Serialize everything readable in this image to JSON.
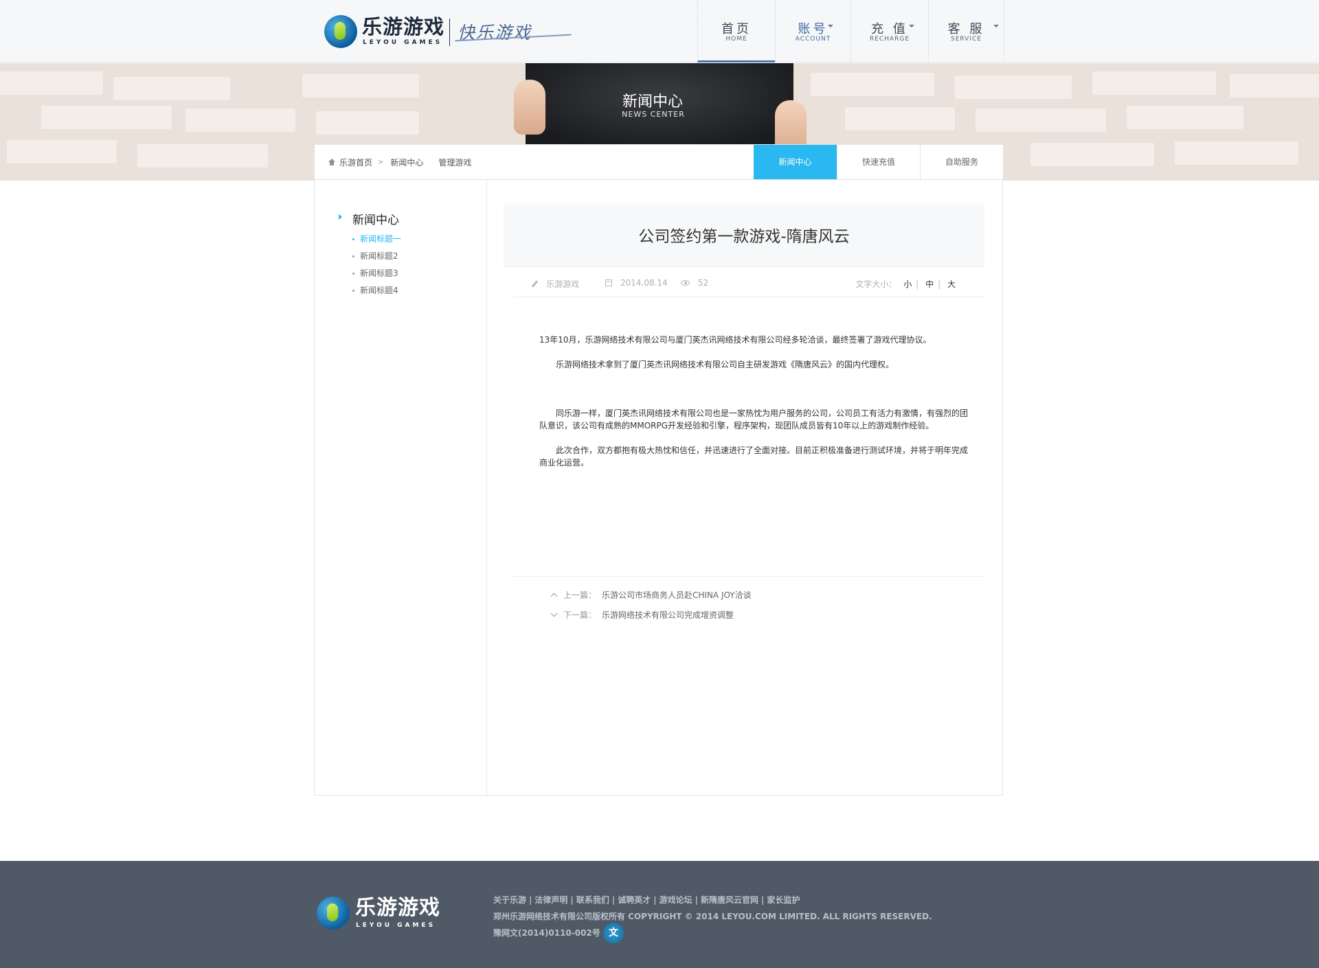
{
  "header": {
    "logo_cn": "乐游游戏",
    "logo_en": "LEYOU GAMES",
    "slogan": "快乐游戏",
    "nav": [
      {
        "cn": "首页",
        "en": "HOME"
      },
      {
        "cn": "账号",
        "en": "ACCOUNT"
      },
      {
        "cn": "充 值",
        "en": "RECHARGE"
      },
      {
        "cn": "客 服",
        "en": "SERVICE"
      }
    ]
  },
  "banner": {
    "title": "新闻中心",
    "subtitle": "NEWS CENTER"
  },
  "breadcrumb": {
    "items": [
      "乐游首页",
      "新闻中心",
      "管理游戏"
    ],
    "separator": ">"
  },
  "tabs": [
    "新闻中心",
    "快速充值",
    "自助服务"
  ],
  "sidebar": {
    "title": "新闻中心",
    "items": [
      "新闻标题一",
      "新闻标题2",
      "新闻标题3",
      "新闻标题4"
    ]
  },
  "article": {
    "title": "公司签约第一款游戏-隋唐风云",
    "author": "乐游游戏",
    "date": "2014.08.14",
    "views": "52",
    "fontsize_label": "文字大小：",
    "fontsize_options": [
      "小",
      "中",
      "大"
    ],
    "paragraphs": [
      "13年10月，乐游网络技术有限公司与厦门英杰讯网络技术有限公司经多轮洽谈，最终签署了游戏代理协议。",
      "　　乐游网络技术拿到了厦门英杰讯网络技术有限公司自主研发游戏《隋唐风云》的国内代理权。",
      "　　同乐游一样，厦门英杰讯网络技术有限公司也是一家热忱为用户服务的公司，公司员工有活力有激情，有强烈的团队意识，该公司有成熟的MMORPG开发经验和引擎，程序架构，现团队成员皆有10年以上的游戏制作经验。",
      "　　此次合作，双方都抱有极大热忱和信任，并迅速进行了全面对接。目前正积极准备进行测试环境，并将于明年完成商业化运营。"
    ],
    "prev_label": "上一篇：",
    "prev_title": "乐游公司市场商务人员赴CHINA JOY洽谈",
    "next_label": "下一篇：",
    "next_title": "乐游网络技术有限公司完成增资调整"
  },
  "footer": {
    "logo_cn": "乐游游戏",
    "logo_en": "LEYOU GAMES",
    "links": [
      "关于乐游",
      "法律声明",
      "联系我们",
      "诚聘英才",
      "游戏论坛",
      "新隋唐风云官网",
      "家长监护"
    ],
    "copyright": "郑州乐游网络技术有限公司版权所有 COPYRIGHT © 2014 LEYOU.COM LIMITED. ALL RIGHTS RESERVED.",
    "license": "豫网文(2014)0110-002号",
    "license_badge": "文"
  }
}
